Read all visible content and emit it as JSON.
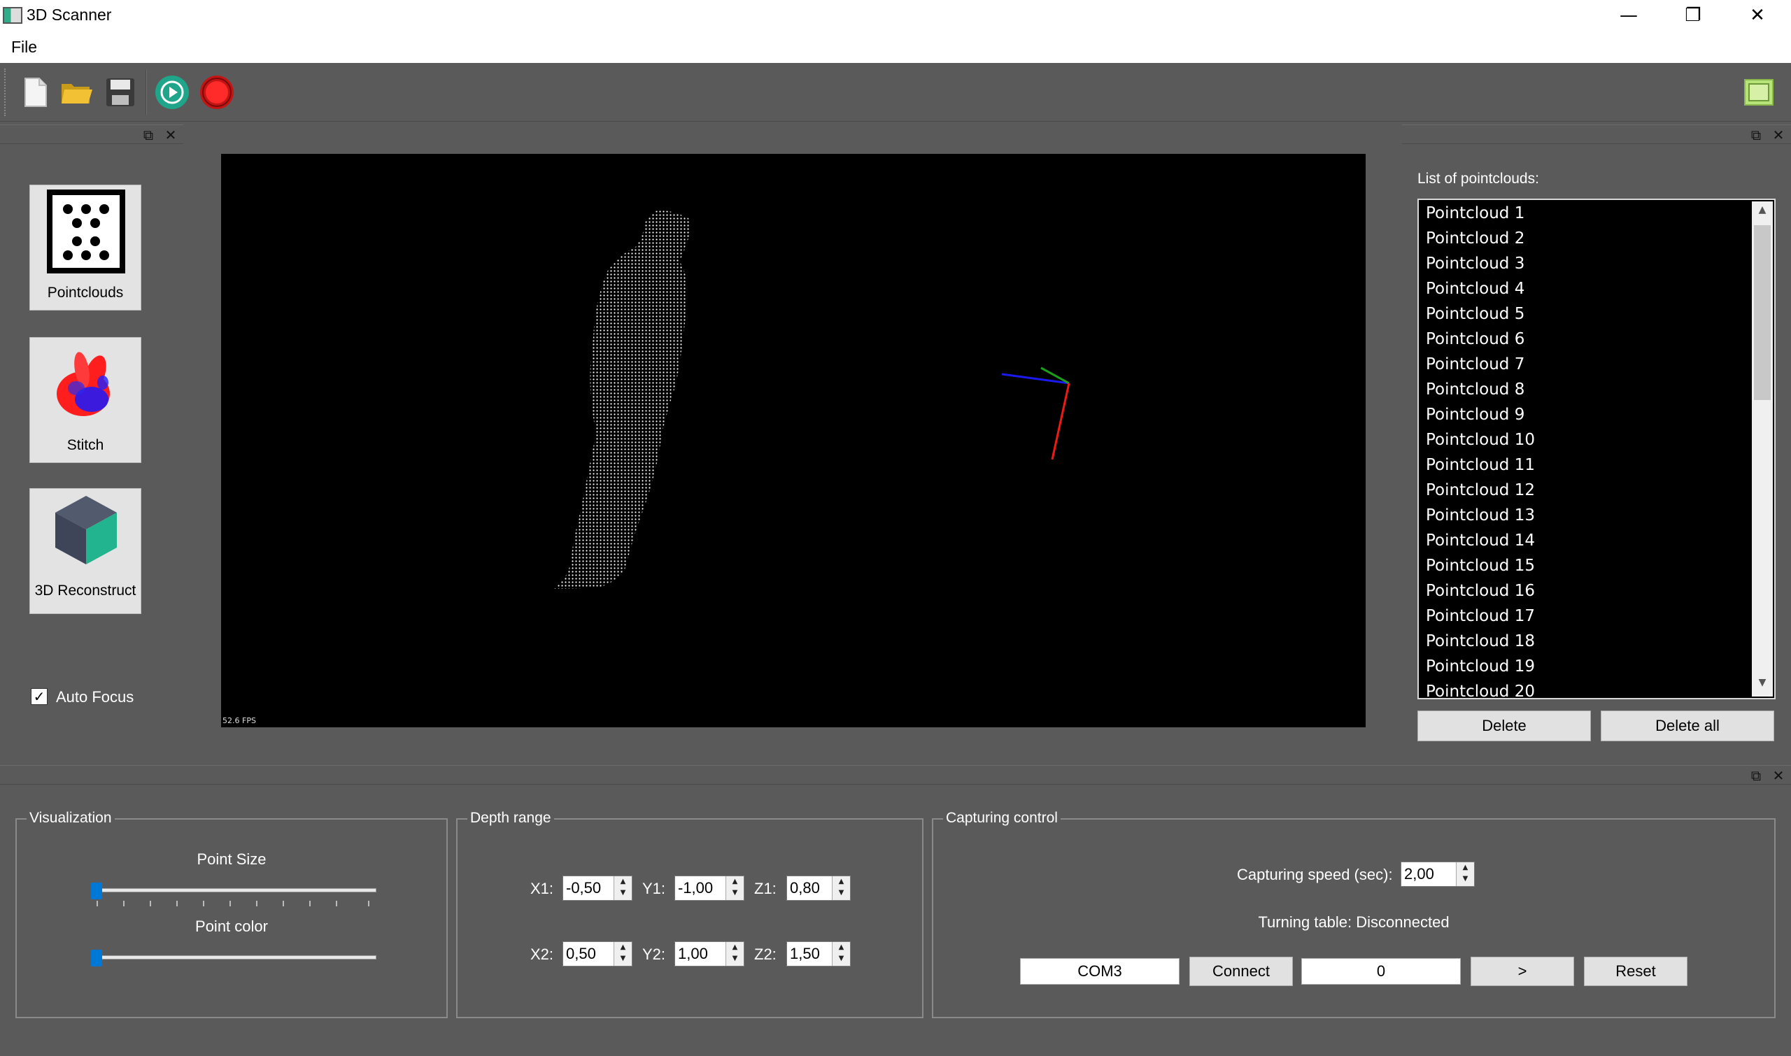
{
  "window": {
    "title": "3D Scanner",
    "controls": {
      "minimize": "—",
      "restore": "❐",
      "close": "✕"
    }
  },
  "menu": {
    "file": "File"
  },
  "toolbar": {
    "icons": [
      "new-file-icon",
      "open-folder-icon",
      "save-icon",
      "play-icon",
      "record-icon",
      "panel-toggle-icon"
    ]
  },
  "left_panel": {
    "tools": [
      {
        "label": "Pointclouds",
        "icon": "pointclouds-icon"
      },
      {
        "label": "Stitch",
        "icon": "stitch-bunny-icon"
      },
      {
        "label": "3D Reconstruct",
        "icon": "cube-icon"
      }
    ],
    "auto_focus": {
      "label": "Auto Focus",
      "checked": true
    }
  },
  "viewer": {
    "fps": "52.6 FPS"
  },
  "right_panel": {
    "title": "List of pointclouds:",
    "items": [
      "Pointcloud 1",
      "Pointcloud 2",
      "Pointcloud 3",
      "Pointcloud 4",
      "Pointcloud 5",
      "Pointcloud 6",
      "Pointcloud 7",
      "Pointcloud 8",
      "Pointcloud 9",
      "Pointcloud 10",
      "Pointcloud 11",
      "Pointcloud 12",
      "Pointcloud 13",
      "Pointcloud 14",
      "Pointcloud 15",
      "Pointcloud 16",
      "Pointcloud 17",
      "Pointcloud 18",
      "Pointcloud 19",
      "Pointcloud 20"
    ],
    "delete": "Delete",
    "delete_all": "Delete all"
  },
  "visualization": {
    "title": "Visualization",
    "point_size": {
      "label": "Point Size",
      "level": 0
    },
    "point_color": {
      "label": "Point color",
      "level": 0
    }
  },
  "depth_range": {
    "title": "Depth range",
    "x1_label": "X1:",
    "x1": "-0,50",
    "y1_label": "Y1:",
    "y1": "-1,00",
    "z1_label": "Z1:",
    "z1": "0,80",
    "x2_label": "X2:",
    "x2": "0,50",
    "y2_label": "Y2:",
    "y2": "1,00",
    "z2_label": "Z2:",
    "z2": "1,50"
  },
  "capturing": {
    "title": "Capturing control",
    "speed_label": "Capturing speed (sec):",
    "speed": "2,00",
    "status": "Turning table: Disconnected",
    "port": "COM3",
    "connect": "Connect",
    "angle": "0",
    "step": ">",
    "reset": "Reset"
  }
}
